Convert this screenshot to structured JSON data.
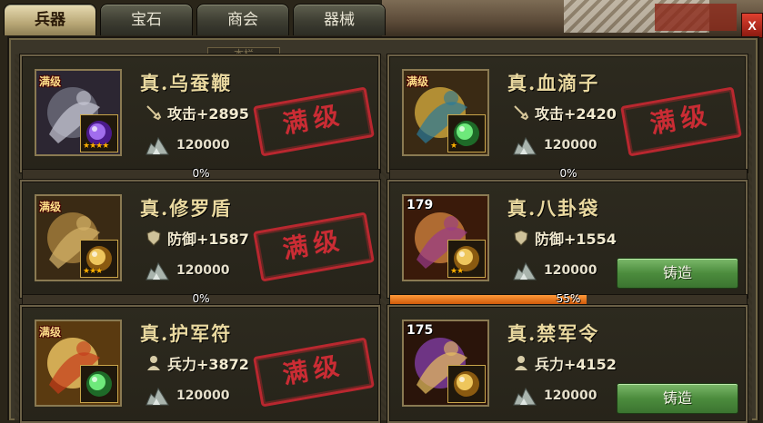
{
  "tabs": [
    {
      "label": "兵器",
      "active": true
    },
    {
      "label": "宝石",
      "active": false
    },
    {
      "label": "商会",
      "active": false
    },
    {
      "label": "器械",
      "active": false
    }
  ],
  "close_label": "X",
  "hanging_tag": "本栏",
  "max_stamp": "满级",
  "forge_label": "铸造",
  "colors": {
    "name": "#ead9a0",
    "stamp": "#dc2d37",
    "forge": "#4c8c3d",
    "progress": "#e06a14"
  },
  "items": [
    {
      "name": "真.乌蚕鞭",
      "badge": "满级",
      "stars": "★★★★",
      "stat_icon": "sword-icon",
      "stat": "攻击+2895",
      "cost": "120000",
      "progress_text": "0%",
      "progress": 0,
      "status": "max",
      "gem": "purple"
    },
    {
      "name": "真.血滴子",
      "badge": "满级",
      "stars": "★",
      "stat_icon": "sword-icon",
      "stat": "攻击+2420",
      "cost": "120000",
      "progress_text": "0%",
      "progress": 0,
      "status": "max",
      "gem": "green"
    },
    {
      "name": "真.修罗盾",
      "badge": "满级",
      "stars": "★★★",
      "stat_icon": "shield-icon",
      "stat": "防御+1587",
      "cost": "120000",
      "progress_text": "0%",
      "progress": 0,
      "status": "max",
      "gem": "gold"
    },
    {
      "name": "真.八卦袋",
      "badge": "179",
      "stars": "★★",
      "stat_icon": "shield-icon",
      "stat": "防御+1554",
      "cost": "120000",
      "progress_text": "55%",
      "progress": 55,
      "status": "forge",
      "gem": "gold"
    },
    {
      "name": "真.护军符",
      "badge": "满级",
      "stars": "",
      "stat_icon": "soldier-icon",
      "stat": "兵力+3872",
      "cost": "120000",
      "progress_text": "",
      "progress": 0,
      "status": "max",
      "gem": "green"
    },
    {
      "name": "真.禁军令",
      "badge": "175",
      "stars": "",
      "stat_icon": "soldier-icon",
      "stat": "兵力+4152",
      "cost": "120000",
      "progress_text": "",
      "progress": 0,
      "status": "forge",
      "gem": "gold"
    }
  ]
}
